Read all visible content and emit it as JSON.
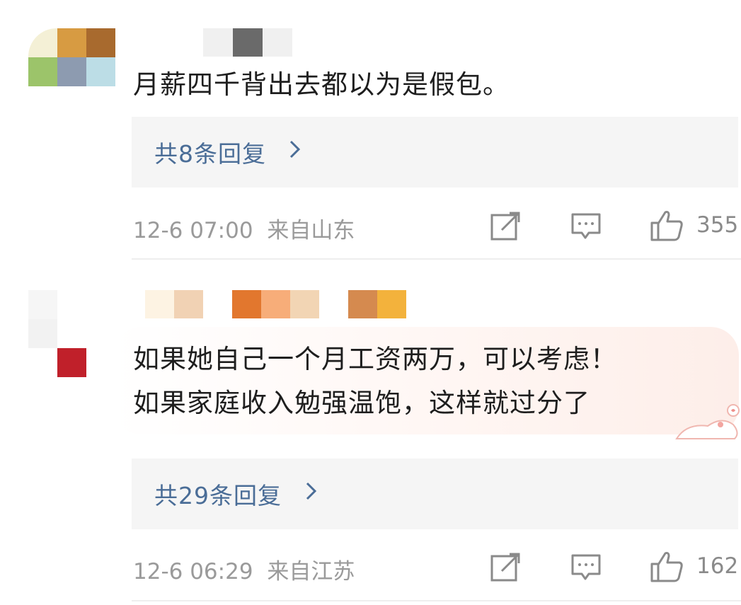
{
  "comments": [
    {
      "text": "月薪四千背出去都以为是假包。",
      "replies_label": "共8条回复",
      "time": "12-6 07:00",
      "location": "来自山东",
      "like_count": "355",
      "avatar_colors": [
        "#f4f0d6",
        "#d79b42",
        "#a86a2e",
        "#9cc46a",
        "#8d9bb0",
        "#bcdde6"
      ],
      "name_colors": [
        "#ffffff",
        "#f0f0f0",
        "#6a6a6a",
        "#f0f0f0"
      ]
    },
    {
      "text_lines": [
        "如果她自己一个月工资两万，可以考虑！",
        "如果家庭收入勉强温饱，这样就过分了"
      ],
      "replies_label": "共29条回复",
      "time": "12-6 06:29",
      "location": "来自江苏",
      "like_count": "162",
      "avatar_colors": [
        "#f6f6f6",
        "#ffffff",
        "#f2f2f2",
        "#ffffff",
        "#ffffff",
        "#c0202a"
      ],
      "name_colors": [
        "#fdf3e3",
        "#f1d2b4",
        "#e2772e",
        "#f7ad79",
        "#f2d5b4",
        "#d58a4f",
        "#f3b23c"
      ]
    }
  ],
  "icons": {
    "share": "share-icon",
    "comment": "comment-icon",
    "like": "like-icon",
    "chevron": "chevron-right-icon"
  },
  "colors": {
    "link": "#4a6d97",
    "meta": "#9a9a9a",
    "replies_bg": "#f5f5f5"
  }
}
